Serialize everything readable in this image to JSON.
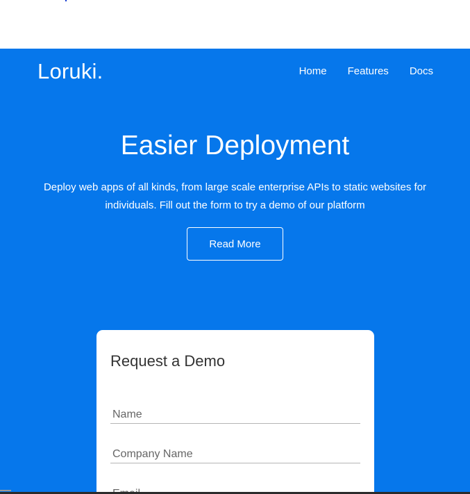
{
  "brand": {
    "name": "Loruki."
  },
  "nav": {
    "items": [
      {
        "label": "Home"
      },
      {
        "label": "Features"
      },
      {
        "label": "Docs"
      }
    ]
  },
  "hero": {
    "title": "Easier Deployment",
    "subtitle": "Deploy web apps of all kinds, from large scale enterprise APIs to static websites for individuals. Fill out the form to try a demo of our platform",
    "button_label": "Read More"
  },
  "demo_form": {
    "title": "Request a Demo",
    "fields": [
      {
        "placeholder": "Name",
        "value": ""
      },
      {
        "placeholder": "Company Name",
        "value": ""
      },
      {
        "placeholder": "Email",
        "value": ""
      }
    ]
  },
  "colors": {
    "hero_background": "#0677eb",
    "card_background": "#ffffff",
    "text_light": "#ffffff"
  }
}
